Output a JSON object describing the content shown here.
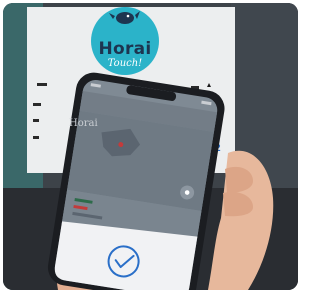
{
  "logo": {
    "name": "Horai",
    "tagline": "Touch!"
  },
  "phone": {
    "app_title": "Horai"
  },
  "colors": {
    "logo_circle": "#2bb3c9",
    "panel_teal": "#3a6e6e",
    "wall": "#3f454c",
    "sheet_card": "#eceeef",
    "phone_body": "#1b1d21",
    "screen": "#7f8a94",
    "sheet": "#f1f2f4",
    "check": "#2a6fc8",
    "skin": "#e7b89c"
  },
  "icons": [
    "check-circle-icon",
    "location-target-icon",
    "bird-mascot-icon"
  ]
}
